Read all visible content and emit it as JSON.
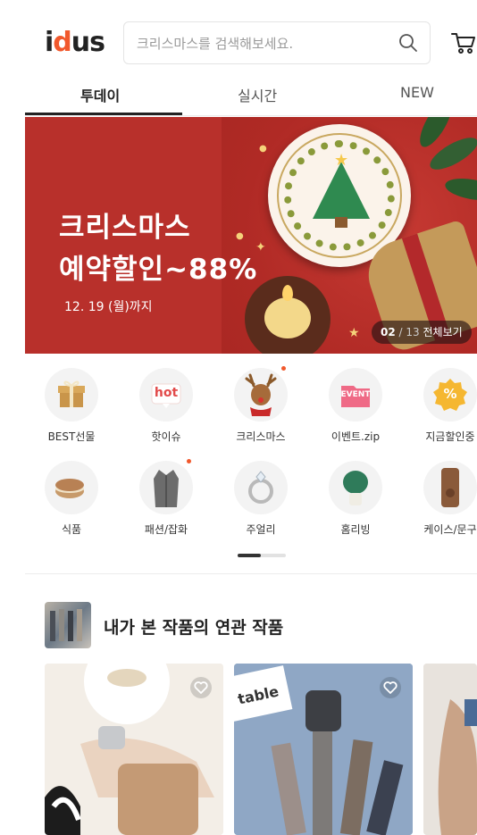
{
  "header": {
    "logo": "idus",
    "search_placeholder": "크리스마스를 검색해보세요."
  },
  "tabs": [
    {
      "label": "투데이",
      "active": true
    },
    {
      "label": "실시간",
      "active": false
    },
    {
      "label": "NEW",
      "active": false
    }
  ],
  "banner": {
    "title_line1": "크리스마스",
    "title_line2": "예약할인~88%",
    "date": "12. 19 (월)까지",
    "counter_current": "02",
    "counter_total": "13",
    "counter_sep": " / ",
    "counter_link": "전체보기"
  },
  "categories": [
    {
      "label": "BEST선물",
      "icon": "gift-box-icon",
      "new": false
    },
    {
      "label": "핫이슈",
      "icon": "hot-icon",
      "icon_text": "hot",
      "new": false
    },
    {
      "label": "크리스마스",
      "icon": "reindeer-icon",
      "new": true
    },
    {
      "label": "이벤트.zip",
      "icon": "event-icon",
      "icon_text": "EVENT",
      "new": false
    },
    {
      "label": "지금할인중",
      "icon": "percent-icon",
      "icon_text": "%",
      "new": false
    },
    {
      "label": "식품",
      "icon": "macaron-icon",
      "new": false
    },
    {
      "label": "패션/잡화",
      "icon": "coat-icon",
      "new": true
    },
    {
      "label": "주얼리",
      "icon": "ring-icon",
      "new": false
    },
    {
      "label": "홈리빙",
      "icon": "plant-icon",
      "new": false
    },
    {
      "label": "케이스/문구",
      "icon": "phone-case-icon",
      "new": false
    }
  ],
  "related": {
    "title": "내가 본 작품의 연관 작품",
    "product_text": "table"
  },
  "colors": {
    "brand": "#f1582c",
    "banner_bg": "#b8302b"
  }
}
